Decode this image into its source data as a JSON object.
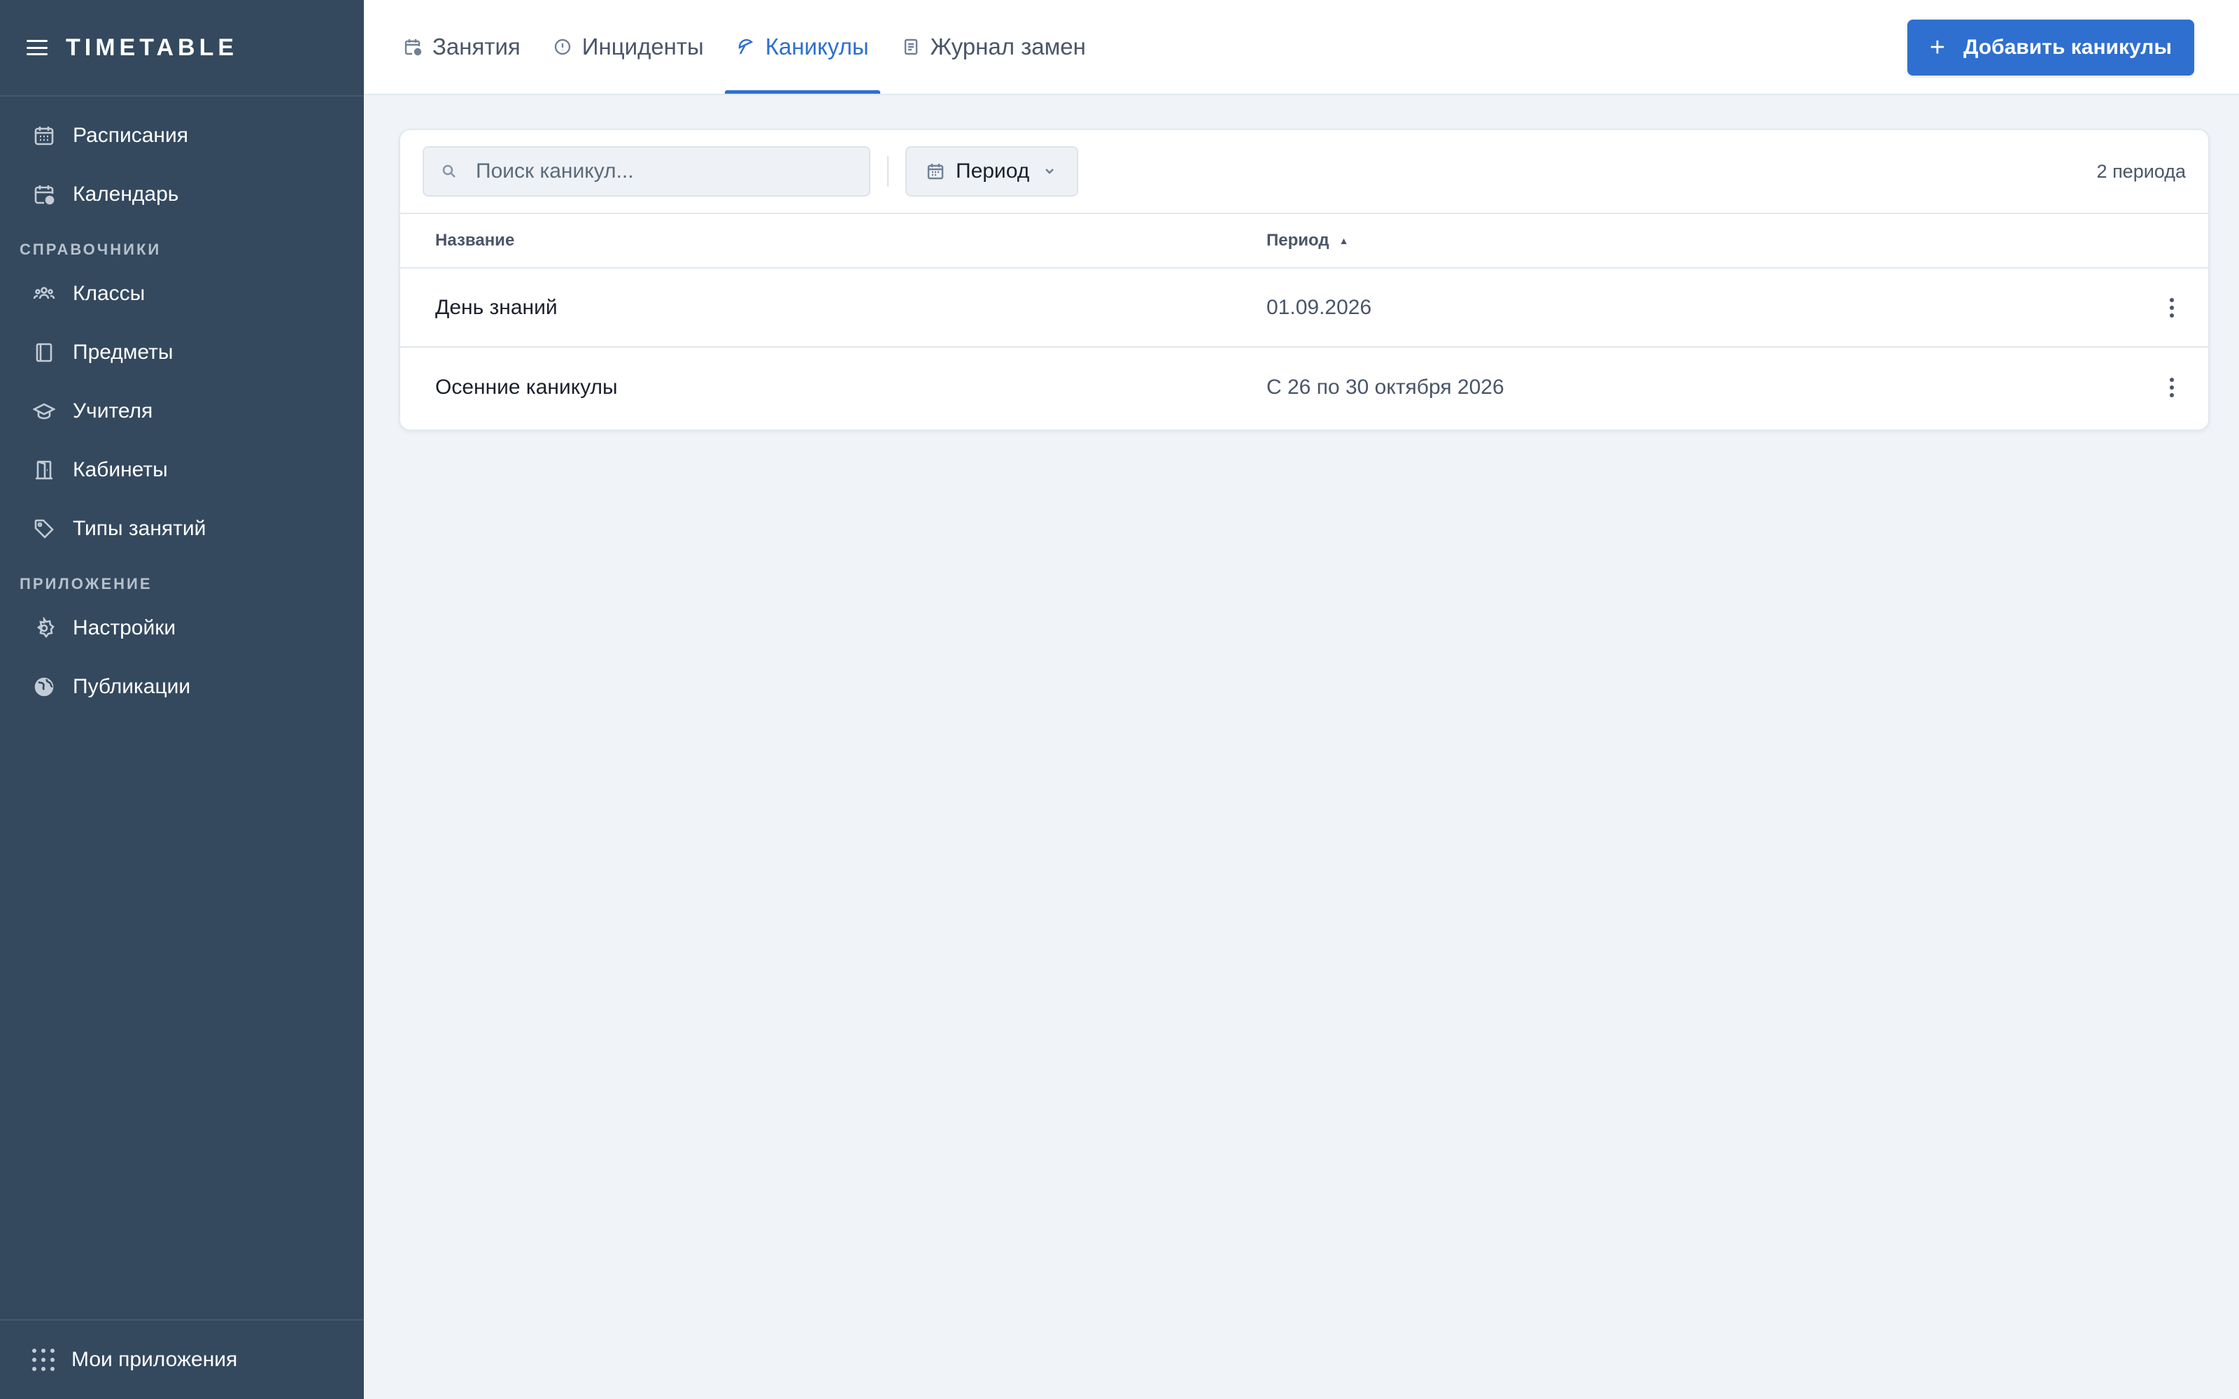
{
  "app": {
    "brand": "TIMETABLE"
  },
  "sidebar": {
    "top_items": [
      {
        "label": "Расписания",
        "icon": "calendar-grid-icon"
      },
      {
        "label": "Календарь",
        "icon": "calendar-clock-icon"
      }
    ],
    "section_refs": "СПРАВОЧНИКИ",
    "ref_items": [
      {
        "label": "Классы",
        "icon": "users-group-icon"
      },
      {
        "label": "Предметы",
        "icon": "book-icon"
      },
      {
        "label": "Учителя",
        "icon": "graduation-cap-icon"
      },
      {
        "label": "Кабинеты",
        "icon": "door-icon"
      },
      {
        "label": "Типы занятий",
        "icon": "tag-icon"
      }
    ],
    "section_app": "ПРИЛОЖЕНИЕ",
    "app_items": [
      {
        "label": "Настройки",
        "icon": "gear-icon"
      },
      {
        "label": "Публикации",
        "icon": "globe-icon"
      }
    ],
    "footer_label": "Мои приложения"
  },
  "tabs": [
    {
      "label": "Занятия",
      "icon": "calendar-clock-icon",
      "active": false
    },
    {
      "label": "Инциденты",
      "icon": "alert-circle-icon",
      "active": false
    },
    {
      "label": "Каникулы",
      "icon": "umbrella-icon",
      "active": true
    },
    {
      "label": "Журнал замен",
      "icon": "document-icon",
      "active": false
    }
  ],
  "add_button": {
    "label": "Добавить каникулы",
    "icon": "plus-icon"
  },
  "toolbar": {
    "search_placeholder": "Поиск каникул...",
    "period_label": "Период",
    "count_label": "2 периода"
  },
  "table": {
    "headers": {
      "name": "Название",
      "period": "Период"
    },
    "rows": [
      {
        "name": "День знаний",
        "period": "01.09.2026"
      },
      {
        "name": "Осенние каникулы",
        "period": "С 26 по 30 октября 2026"
      }
    ]
  },
  "colors": {
    "sidebar_bg": "#34495e",
    "accent": "#2f6fcf",
    "page_bg": "#f0f4f8"
  }
}
